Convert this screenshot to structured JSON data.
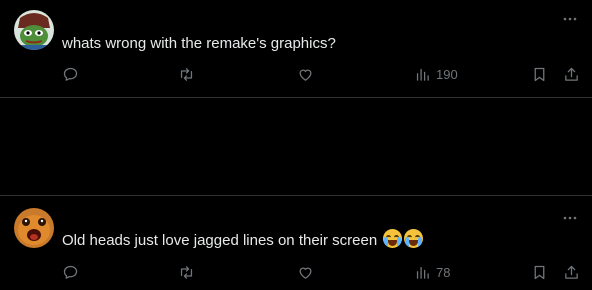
{
  "posts": [
    {
      "text": "whats wrong with the remake's graphics?",
      "views": "190",
      "emojis": []
    },
    {
      "text": "Old heads just love jagged lines on their screen",
      "views": "78",
      "emojis": [
        "loudly-crying-face",
        "loudly-crying-face"
      ]
    }
  ],
  "colors": {
    "background": "#000000",
    "text": "#e7e9ea",
    "muted": "#71767b",
    "divider": "#2f3336"
  }
}
